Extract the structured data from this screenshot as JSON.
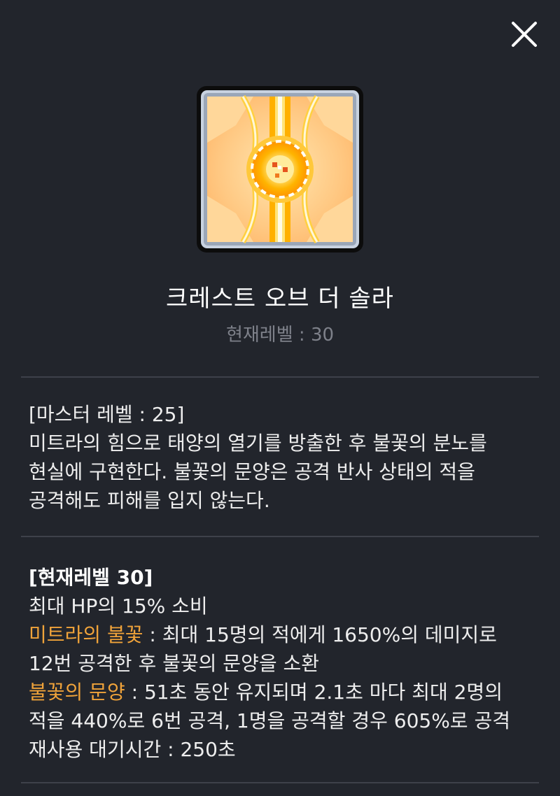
{
  "close_button": {
    "icon": "close-icon"
  },
  "skill": {
    "icon": "solar-crest-skill-icon",
    "name": "크레스트 오브 더 솔라",
    "current_level": "현재레벨 : 30"
  },
  "description": {
    "master_level": "[마스터 레벨 : 25]",
    "lines": [
      "미트라의 힘으로 태양의 열기를 방출한 후 불꽃의 분노를",
      "현실에 구현한다. 불꽃의 문양은 공격 반사 상태의 적을",
      "공격해도 피해를 입지 않는다."
    ]
  },
  "level_details": {
    "header": "[현재레벨 30]",
    "hp_cost": "최대 HP의 15% 소비",
    "flame_label": "미트라의 불꽃",
    "flame_text": " : 최대 15명의 적에게 1650%의 데미지로",
    "flame_text_2": "12번 공격한 후 불꽃의 문양을 소환",
    "sigil_label": "불꽃의 문양",
    "sigil_text": " : 51초 동안 유지되며 2.1초 마다 최대 2명의",
    "sigil_text_2": "적을 440%로 6번 공격, 1명을 공격할 경우 605%로 공격",
    "cooldown": "재사용 대기시간 : 250초"
  },
  "colors": {
    "background": "#22252c",
    "divider": "#3e414a",
    "highlight": "#f0a33a",
    "muted": "#7e818a"
  }
}
